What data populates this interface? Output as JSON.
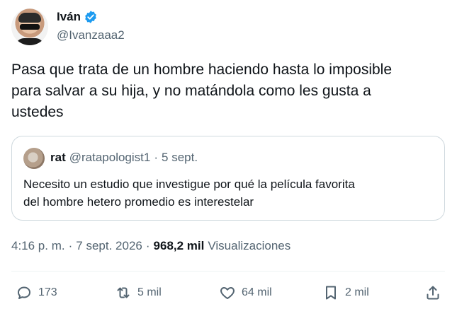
{
  "author": {
    "name": "Iván",
    "handle": "@Ivanzaaa2"
  },
  "tweet": {
    "text": "Pasa que trata de un hombre haciendo hasta lo imposible\npara salvar a su hija, y no matándola como les gusta a\nustedes"
  },
  "quote": {
    "name": "rat",
    "handle": "@ratapologist1",
    "separator": "·",
    "date": "5 sept.",
    "text": "Necesito un estudio que investigue por qué la película favorita\ndel hombre hetero promedio es interestelar"
  },
  "meta": {
    "time": "4:16 p. m.",
    "sep1": "·",
    "date": "7 sept. 2026",
    "sep2": "·",
    "views_count": "968,2 mil",
    "views_label": "Visualizaciones"
  },
  "actions": {
    "replies": "173",
    "retweets": "5 mil",
    "likes": "64 mil",
    "bookmarks": "2 mil"
  },
  "icons": {
    "verified": "verified-badge-icon",
    "reply": "reply-icon",
    "retweet": "retweet-icon",
    "like": "heart-icon",
    "bookmark": "bookmark-icon",
    "share": "share-icon"
  },
  "colors": {
    "accent": "#1d9bf0",
    "text": "#0f1419",
    "muted": "#536471",
    "border": "#cfd9de"
  }
}
